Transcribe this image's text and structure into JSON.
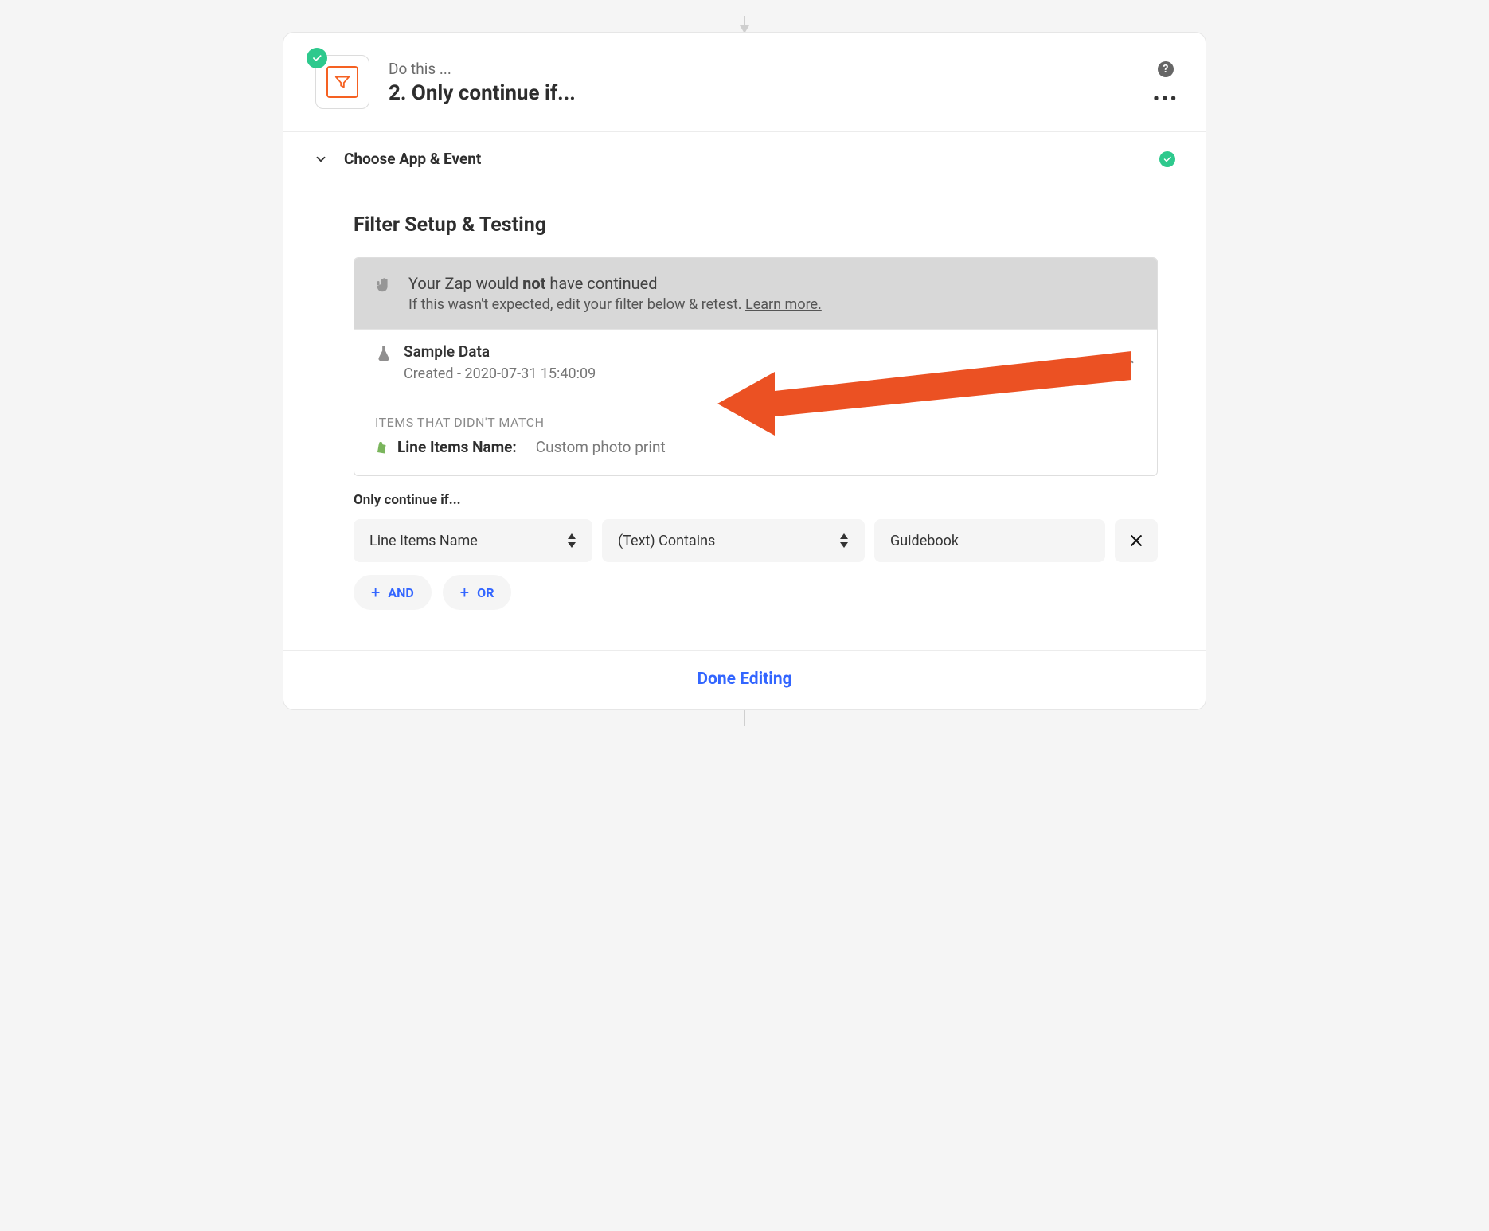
{
  "header": {
    "kicker": "Do this ...",
    "title": "2. Only continue if..."
  },
  "chooseSection": {
    "label": "Choose App & Event"
  },
  "filterSection": {
    "heading": "Filter Setup & Testing",
    "banner_title_pre": "Your Zap would ",
    "banner_title_bold": "not",
    "banner_title_post": " have continued",
    "banner_sub_pre": "If this wasn't expected, edit your filter below & retest. ",
    "learn_more": "Learn more."
  },
  "sample": {
    "title": "Sample Data",
    "meta": "Created - 2020-07-31 15:40:09"
  },
  "noMatch": {
    "label": "ITEMS THAT DIDN'T MATCH",
    "field": "Line Items Name:",
    "value": "Custom photo print"
  },
  "rule": {
    "label": "Only continue if...",
    "field": "Line Items Name",
    "operator": "(Text) Contains",
    "value": "Guidebook",
    "and": "AND",
    "or": "OR"
  },
  "footer": {
    "done": "Done Editing"
  }
}
